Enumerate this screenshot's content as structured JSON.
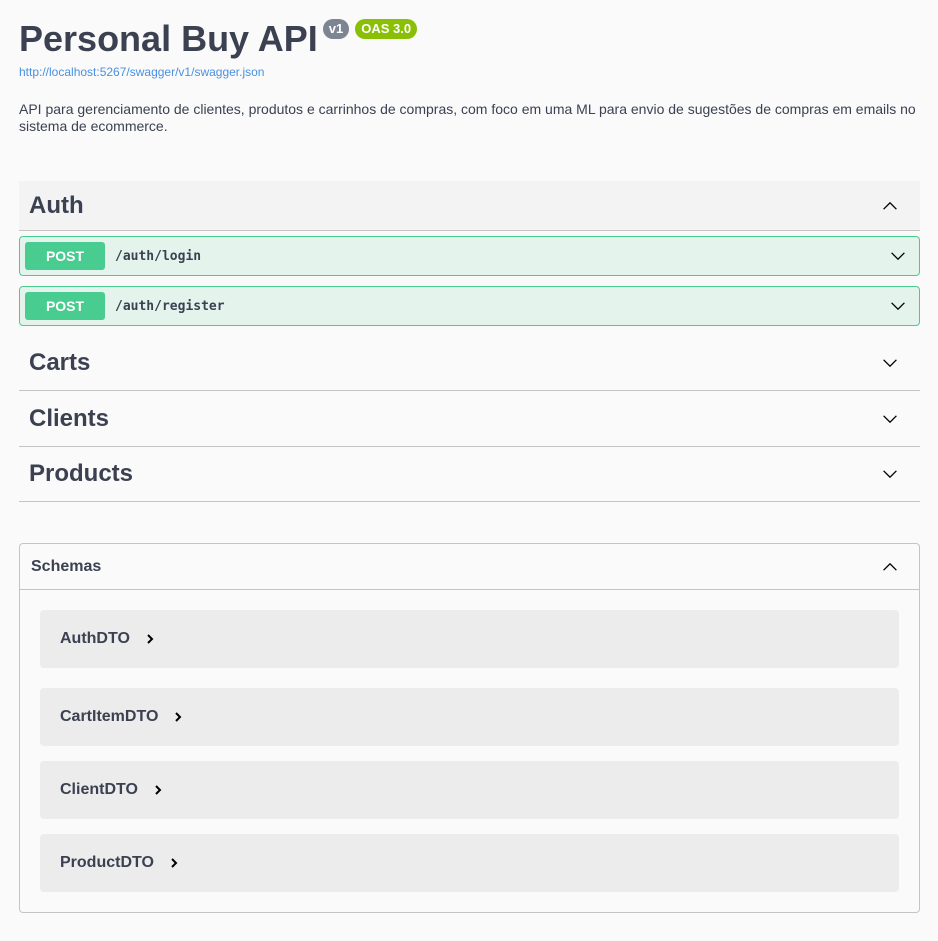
{
  "info": {
    "title": "Personal Buy API",
    "version_badge": "v1",
    "oas_badge": "OAS 3.0",
    "spec_url": "http://localhost:5267/swagger/v1/swagger.json",
    "description": "API para gerenciamento de clientes, produtos e carrinhos de compras, com foco em uma ML para envio de sugestões de compras em emails no sistema de ecommerce."
  },
  "tags": [
    {
      "name": "Auth",
      "expanded": true,
      "operations": [
        {
          "method": "POST",
          "path": "/auth/login"
        },
        {
          "method": "POST",
          "path": "/auth/register"
        }
      ]
    },
    {
      "name": "Carts",
      "expanded": false
    },
    {
      "name": "Clients",
      "expanded": false
    },
    {
      "name": "Products",
      "expanded": false
    }
  ],
  "schemas": {
    "title": "Schemas",
    "expanded": true,
    "models": [
      "AuthDTO",
      "CartItemDTO",
      "ClientDTO",
      "ProductDTO"
    ]
  },
  "colors": {
    "post": "#49cc90",
    "version_badge": "#7d8492",
    "oas_badge": "#89bf04",
    "link": "#4990e2"
  },
  "icons": {
    "expanded": "chevron-up-icon",
    "collapsed": "chevron-down-icon",
    "model_toggle": "chevron-right-icon"
  }
}
